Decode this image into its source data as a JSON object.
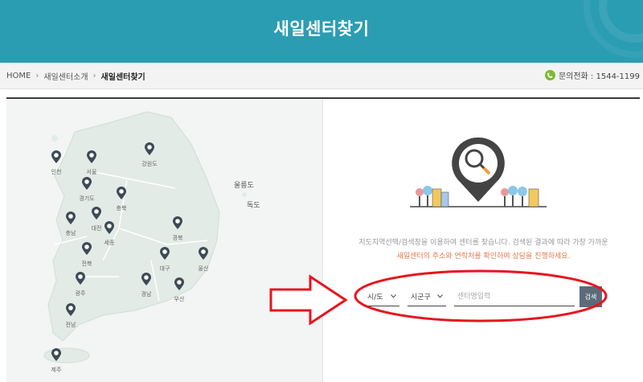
{
  "banner": {
    "title": "새일센터찾기"
  },
  "breadcrumb": {
    "home": "HOME",
    "section": "새일센터소개",
    "current": "새일센터찾기"
  },
  "contact": {
    "label": "문의전화 : 1544-1199"
  },
  "map": {
    "regions": [
      {
        "id": "incheon",
        "label": "인천"
      },
      {
        "id": "seoul",
        "label": "서울"
      },
      {
        "id": "gyeonggi",
        "label": "경기도"
      },
      {
        "id": "gangwon",
        "label": "강원도"
      },
      {
        "id": "chungbuk",
        "label": "충북"
      },
      {
        "id": "chungnam",
        "label": "충남"
      },
      {
        "id": "daejeon",
        "label": "대전"
      },
      {
        "id": "sejong",
        "label": "세종"
      },
      {
        "id": "gyeongbuk",
        "label": "경북"
      },
      {
        "id": "jeonbuk",
        "label": "전북"
      },
      {
        "id": "daegu",
        "label": "대구"
      },
      {
        "id": "ulsan",
        "label": "울산"
      },
      {
        "id": "gwangju",
        "label": "광주"
      },
      {
        "id": "gyeongnam",
        "label": "경남"
      },
      {
        "id": "busan",
        "label": "부산"
      },
      {
        "id": "jeonnam",
        "label": "전남"
      },
      {
        "id": "jeju",
        "label": "제주"
      }
    ],
    "islands": {
      "ulleung": "울릉도",
      "dokdo": "독도"
    }
  },
  "guide": {
    "line1": "지도지역선택/검색창을 이용하여 센터를 찾습니다. 검색된 결과에 따라 가장 가까운",
    "line2": "새일센터의 주소와 연락처를 확인하여 상담을 진행하세요."
  },
  "search": {
    "province_value": "시/도",
    "district_value": "시군구",
    "center_placeholder": "센터명입력",
    "button_label": "검색"
  },
  "colors": {
    "banner": "#2b9db3",
    "accent_orange": "#e0784b",
    "search_button": "#5c6b7a",
    "annotation_red": "#e8141e"
  }
}
